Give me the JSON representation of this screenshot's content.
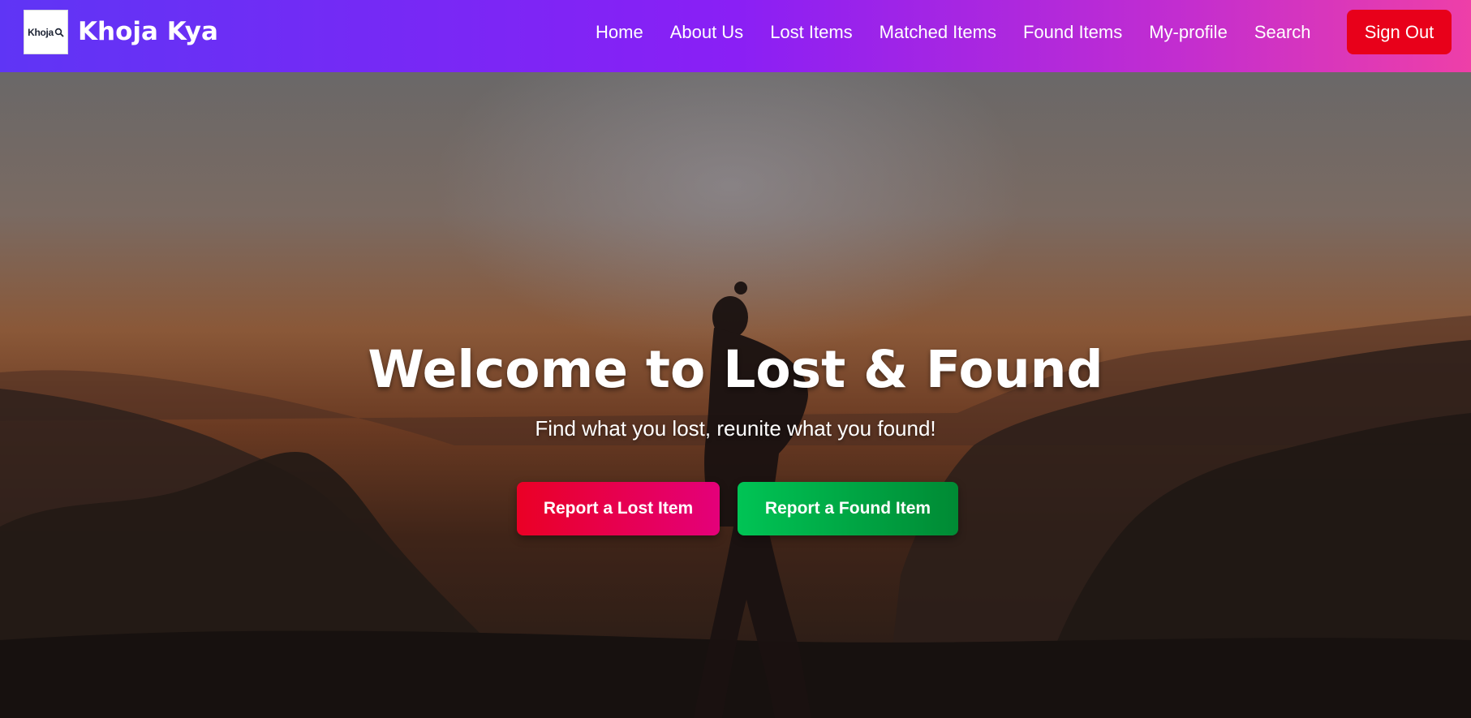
{
  "header": {
    "logo_text": "Khoja",
    "logo_icon": "magnifier-icon",
    "brand": "Khoja Kya",
    "nav": [
      {
        "label": "Home"
      },
      {
        "label": "About Us"
      },
      {
        "label": "Lost Items"
      },
      {
        "label": "Matched Items"
      },
      {
        "label": "Found Items"
      },
      {
        "label": "My-profile"
      },
      {
        "label": "Search"
      }
    ],
    "sign_out": "Sign Out",
    "gradient": [
      "#5f35f5",
      "#8a1ff5",
      "#ee3fa8"
    ],
    "sign_out_color": "#e8001a"
  },
  "hero": {
    "title": "Welcome to Lost & Found",
    "subtitle": "Find what you lost, reunite what you found!",
    "lost_button": "Report a Lost Item",
    "found_button": "Report a Found Item",
    "lost_color": "#ea0025",
    "found_color": "#00c455"
  }
}
